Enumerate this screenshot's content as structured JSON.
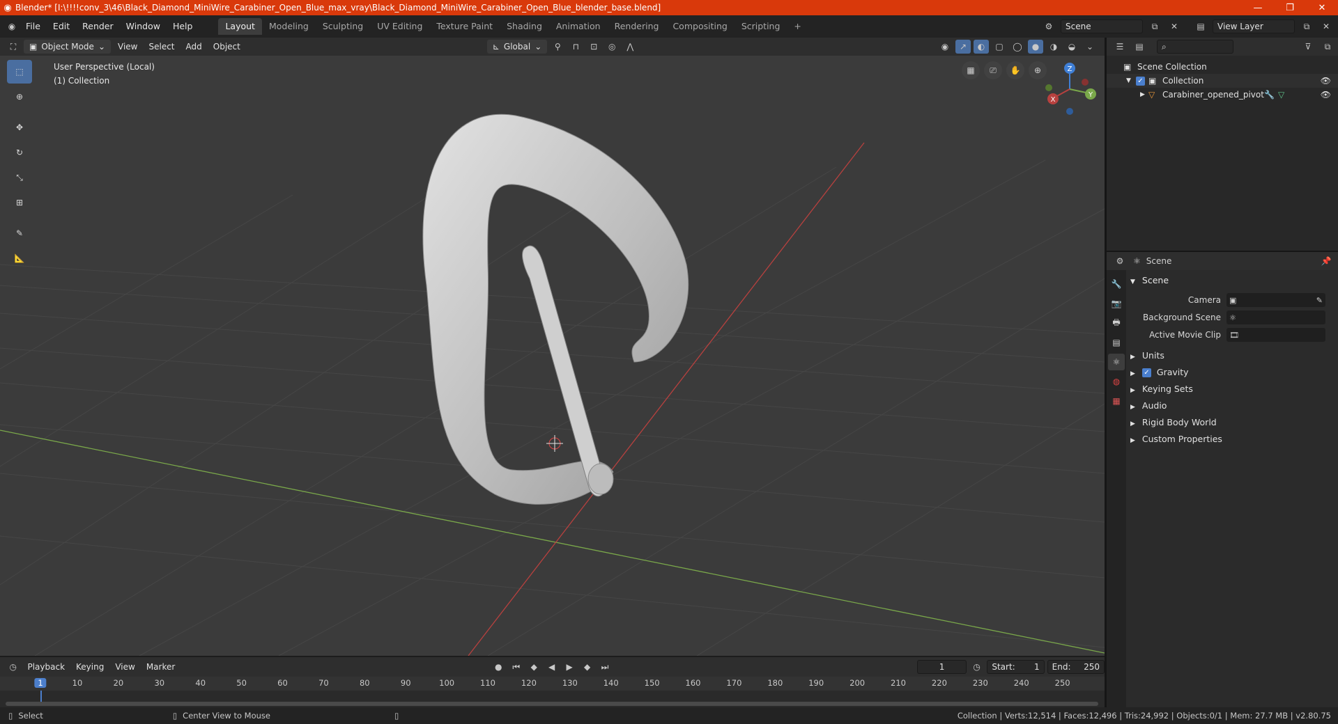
{
  "window": {
    "title": "Blender* [I:\\!!!!conv_3\\46\\Black_Diamond_MiniWire_Carabiner_Open_Blue_max_vray\\Black_Diamond_MiniWire_Carabiner_Open_Blue_blender_base.blend]",
    "minimize": "—",
    "maximize": "❐",
    "close": "✕"
  },
  "menu": [
    "File",
    "Edit",
    "Render",
    "Window",
    "Help"
  ],
  "workspaces": [
    "Layout",
    "Modeling",
    "Sculpting",
    "UV Editing",
    "Texture Paint",
    "Shading",
    "Animation",
    "Rendering",
    "Compositing",
    "Scripting"
  ],
  "workspace_add": "+",
  "scene_selector": {
    "value": "Scene"
  },
  "viewlayer_selector": {
    "value": "View Layer"
  },
  "header3d": {
    "mode": "Object Mode",
    "menus": [
      "View",
      "Select",
      "Add",
      "Object"
    ],
    "transform_orientation": "Global"
  },
  "viewport": {
    "info_line1": "User Perspective (Local)",
    "info_line2": "(1) Collection",
    "gizmo_axes": {
      "x": "X",
      "y": "Y",
      "z": "Z"
    }
  },
  "timeline": {
    "menus": [
      "Playback",
      "Keying",
      "View",
      "Marker"
    ],
    "current_frame": "1",
    "start_label": "Start:",
    "start_value": "1",
    "end_label": "End:",
    "end_value": "250",
    "ruler": [
      "1",
      "10",
      "20",
      "30",
      "40",
      "50",
      "60",
      "70",
      "80",
      "90",
      "100",
      "110",
      "120",
      "130",
      "140",
      "150",
      "160",
      "170",
      "180",
      "190",
      "200",
      "210",
      "220",
      "230",
      "240",
      "250"
    ]
  },
  "outliner": {
    "root": "Scene Collection",
    "collection": "Collection",
    "object": "Carabiner_opened_pivot"
  },
  "properties": {
    "header_title": "Scene",
    "panel_title": "Scene",
    "camera_label": "Camera",
    "background_scene_label": "Background Scene",
    "active_movie_clip_label": "Active Movie Clip",
    "subpanels": {
      "units": "Units",
      "gravity": "Gravity",
      "keying_sets": "Keying Sets",
      "audio": "Audio",
      "rigid_body_world": "Rigid Body World",
      "custom_properties": "Custom Properties"
    }
  },
  "statusbar": {
    "select": "Select",
    "center_view": "Center View to Mouse",
    "stats": "Collection | Verts:12,514 | Faces:12,496 | Tris:24,992 | Objects:0/1 | Mem: 27.7 MB | v2.80.75"
  },
  "colors": {
    "titlebar": "#d9390b",
    "accent": "#4a7fce",
    "x_axis": "#b8413f",
    "y_axis": "#7aa84a",
    "z_axis": "#3f7fd6"
  }
}
